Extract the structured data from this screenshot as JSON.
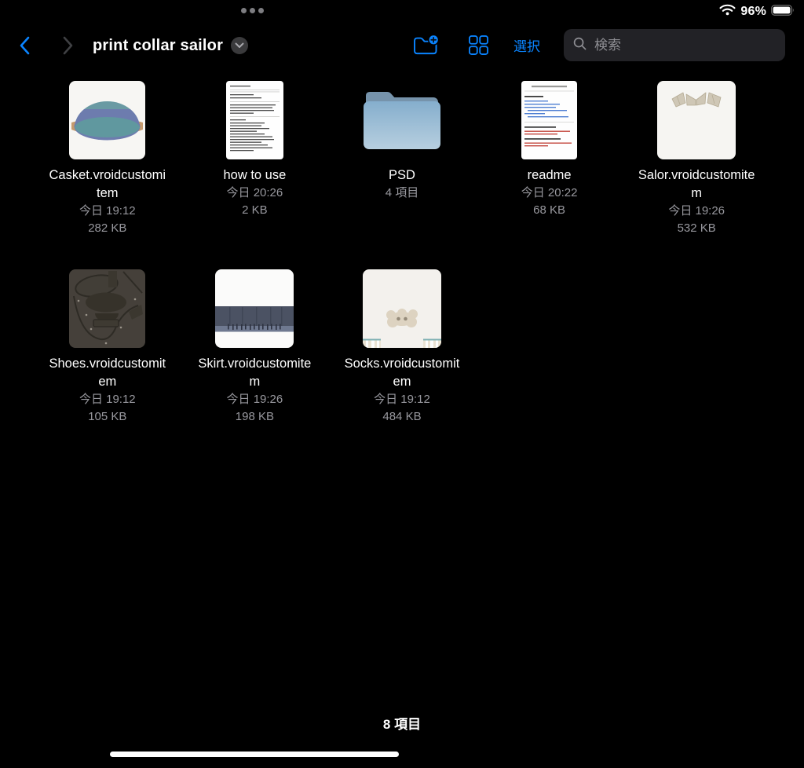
{
  "status_bar": {
    "battery_percent": "96%",
    "wifi_icon": "wifi-icon",
    "battery_icon": "battery-icon",
    "multitask_indicator_icon": "ellipsis-dots-icon"
  },
  "nav": {
    "title": "print collar sailor",
    "back_icon": "chevron-left-icon",
    "forward_icon": "chevron-right-icon",
    "title_menu_icon": "chevron-down-icon",
    "new_folder_icon": "new-folder-icon",
    "view_toggle_icon": "grid-view-icon",
    "select_label": "選択",
    "search_icon": "search-icon",
    "search_placeholder": "検索",
    "search_value": ""
  },
  "files": [
    {
      "name": "Casket.vroidcustomitem",
      "meta1": "今日 19:12",
      "meta2": "282 KB",
      "kind": "casket"
    },
    {
      "name": "how to use",
      "meta1": "今日 20:26",
      "meta2": "2 KB",
      "kind": "text-doc"
    },
    {
      "name": "PSD",
      "meta1": "4 項目",
      "meta2": "",
      "kind": "folder"
    },
    {
      "name": "readme",
      "meta1": "今日 20:22",
      "meta2": "68 KB",
      "kind": "readme-doc"
    },
    {
      "name": "Salor.vroidcustomitem",
      "meta1": "今日 19:26",
      "meta2": "532 KB",
      "kind": "salor"
    },
    {
      "name": "Shoes.vroidcustomitem",
      "meta1": "今日 19:12",
      "meta2": "105 KB",
      "kind": "shoes"
    },
    {
      "name": "Skirt.vroidcustomitem",
      "meta1": "今日 19:26",
      "meta2": "198 KB",
      "kind": "skirt"
    },
    {
      "name": "Socks.vroidcustomitem",
      "meta1": "今日 19:12",
      "meta2": "484 KB",
      "kind": "socks"
    }
  ],
  "footer": {
    "item_count": "8 項目",
    "home_indicator_icon": "home-indicator"
  },
  "colors": {
    "background": "#000000",
    "accent": "#0a84ff",
    "file_name_text": "#ffffff",
    "meta_text": "#98989e",
    "search_field_bg": "#222226",
    "folder_icon_blue": "#9cbdd8"
  }
}
